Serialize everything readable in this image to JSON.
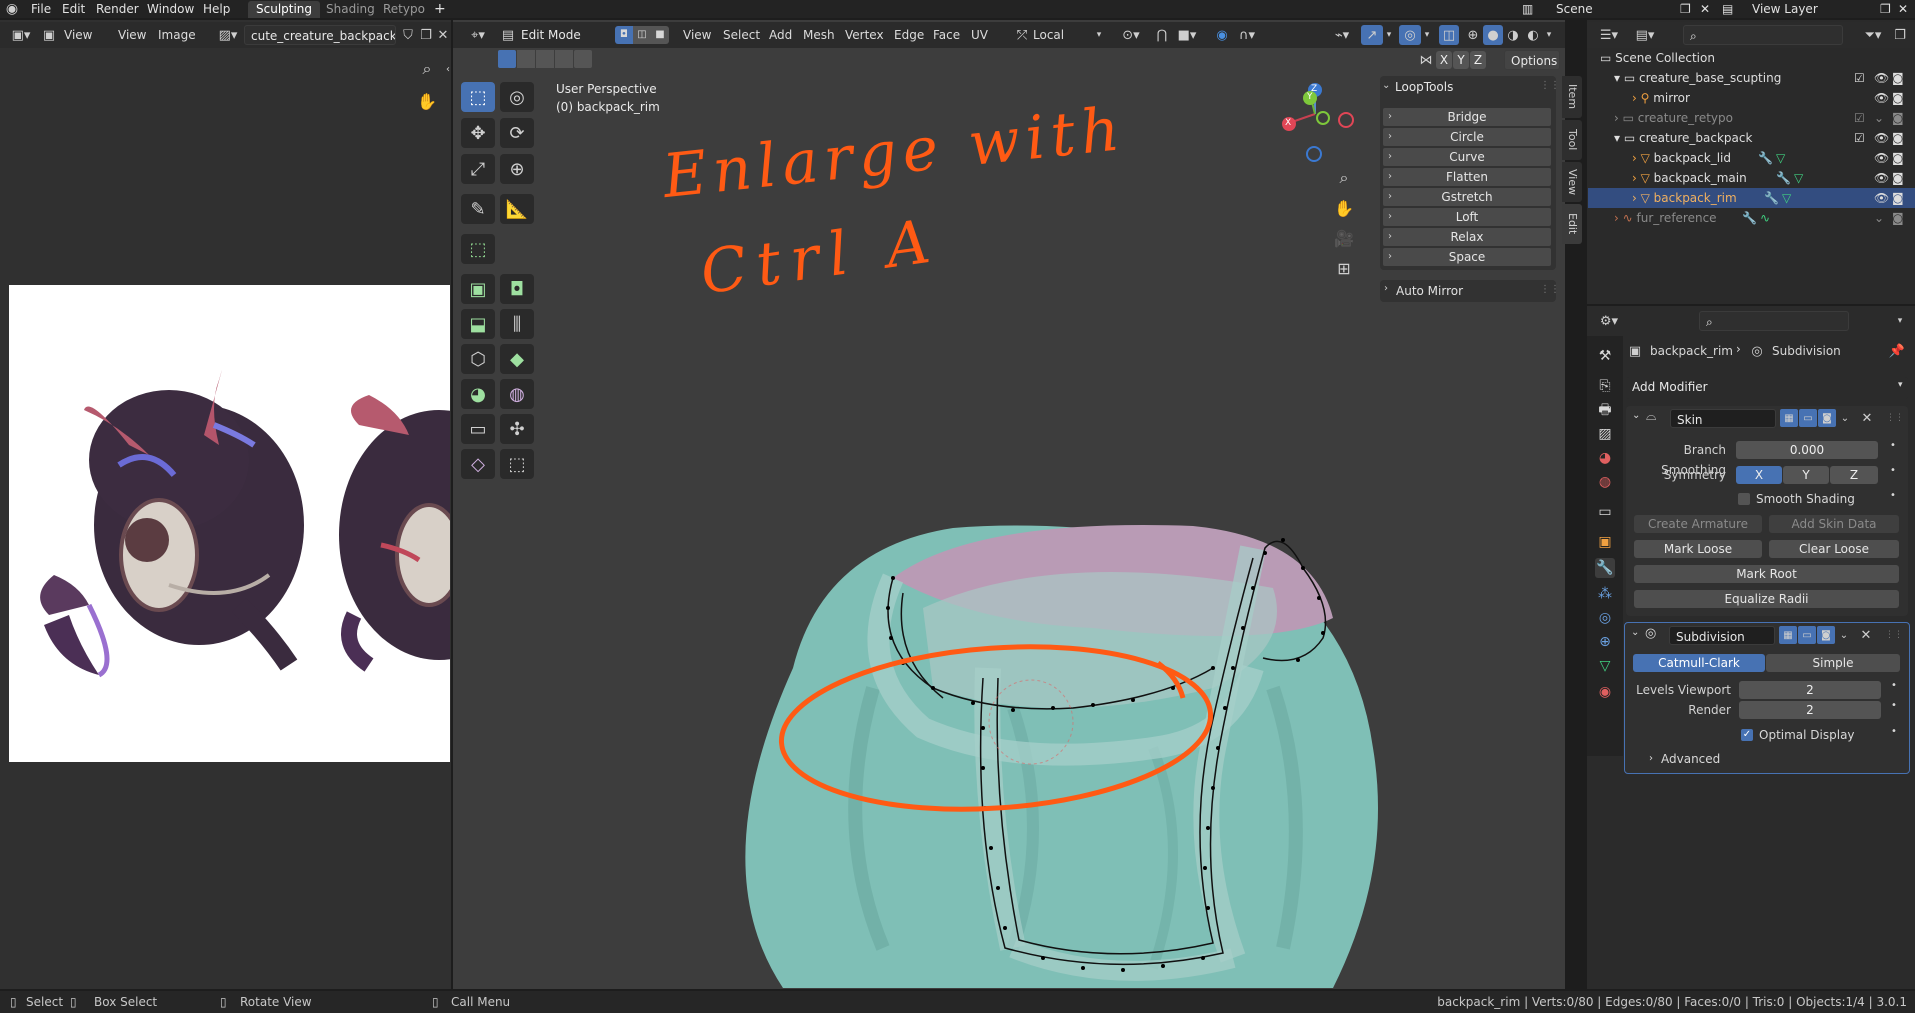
{
  "menu": [
    "File",
    "Edit",
    "Render",
    "Window",
    "Help"
  ],
  "workspaces": [
    "Sculpting",
    "Shading",
    "Retypo"
  ],
  "scene": "Scene",
  "view_layer": "View Layer",
  "image_editor": {
    "view": "View",
    "menu_view": "View",
    "menu_image": "Image",
    "image_name": "cute_creature_backpack.jpg"
  },
  "viewport": {
    "mode": "Edit Mode",
    "menus": [
      "View",
      "Select",
      "Add",
      "Mesh",
      "Vertex",
      "Edge",
      "Face",
      "UV"
    ],
    "transform": "Local",
    "options": "Options",
    "axes": [
      "X",
      "Y",
      "Z"
    ],
    "perspective": "User Perspective",
    "object": "(0) backpack_rim",
    "annotation_line1": "Enlarge with",
    "annotation_line2": "Ctrl A"
  },
  "looptools": {
    "title": "LoopTools",
    "items": [
      "Bridge",
      "Circle",
      "Curve",
      "Flatten",
      "Gstretch",
      "Loft",
      "Relax",
      "Space"
    ],
    "auto_mirror": "Auto Mirror"
  },
  "sidebar_tabs": [
    "Item",
    "Tool",
    "View",
    "Edit"
  ],
  "outliner": {
    "rows": [
      {
        "label": "Scene Collection"
      },
      {
        "label": "creature_base_scupting"
      },
      {
        "label": "mirror"
      },
      {
        "label": "creature_retypo"
      },
      {
        "label": "creature_backpack"
      },
      {
        "label": "backpack_lid"
      },
      {
        "label": "backpack_main"
      },
      {
        "label": "backpack_rim"
      },
      {
        "label": "fur_reference"
      }
    ]
  },
  "properties": {
    "breadcrumb_object": "backpack_rim",
    "breadcrumb_modifier": "Subdivision",
    "add_modifier": "Add Modifier",
    "skin": {
      "name": "Skin",
      "branch_smoothing_label": "Branch Smoothing",
      "branch_smoothing": "0.000",
      "symmetry_label": "Symmetry",
      "sym": [
        "X",
        "Y",
        "Z"
      ],
      "smooth_shading": "Smooth Shading",
      "create_armature": "Create Armature",
      "add_skin_data": "Add Skin Data",
      "mark_loose": "Mark Loose",
      "clear_loose": "Clear Loose",
      "mark_root": "Mark Root",
      "equalize_radii": "Equalize Radii"
    },
    "subdivision": {
      "name": "Subdivision",
      "catmull": "Catmull-Clark",
      "simple": "Simple",
      "levels_viewport_label": "Levels Viewport",
      "levels_viewport": "2",
      "render_label": "Render",
      "render": "2",
      "optimal_display": "Optimal Display",
      "advanced": "Advanced"
    }
  },
  "status": {
    "select": "Select",
    "box_select": "Box Select",
    "rotate": "Rotate View",
    "call_menu": "Call Menu",
    "stats": "backpack_rim | Verts:0/80 | Edges:0/80 | Faces:0/0 | Tris:0 | Objects:1/4 | 3.0.1"
  },
  "colors": {
    "accent": "#4772b3",
    "annotation": "#ff5a14",
    "mesh": "#8cc9c0",
    "selection": "#334d80"
  }
}
